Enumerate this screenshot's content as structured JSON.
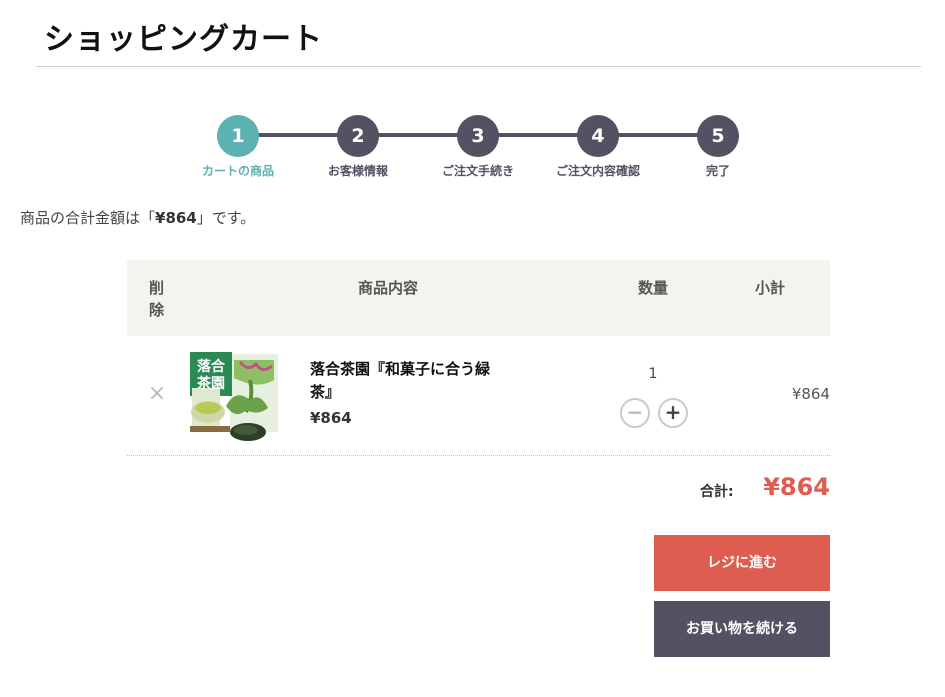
{
  "page": {
    "title": "ショッピングカート"
  },
  "steps": [
    {
      "number": "1",
      "label": "カートの商品",
      "active": true
    },
    {
      "number": "2",
      "label": "お客様情報",
      "active": false
    },
    {
      "number": "3",
      "label": "ご注文手続き",
      "active": false
    },
    {
      "number": "4",
      "label": "ご注文内容確認",
      "active": false
    },
    {
      "number": "5",
      "label": "完了",
      "active": false
    }
  ],
  "message": {
    "prefix": "商品の合計金額は「",
    "amount": "¥864",
    "suffix": "」です。"
  },
  "table": {
    "headers": {
      "delete": "削除",
      "content": "商品内容",
      "quantity": "数量",
      "subtotal": "小計"
    },
    "rows": [
      {
        "remove_icon": "close-icon",
        "thumb_text": "落合茶園",
        "name": "落合茶園『和菓子に合う緑茶』",
        "price": "¥864",
        "quantity": "1",
        "subtotal": "¥864"
      }
    ]
  },
  "total": {
    "label": "合計:",
    "value": "¥864"
  },
  "buttons": {
    "checkout": "レジに進む",
    "continue": "お買い物を続ける"
  },
  "colors": {
    "accent_teal": "#5cb1b1",
    "dark": "#525263",
    "red": "#de5d50",
    "header_bg": "#f4f3f0"
  }
}
